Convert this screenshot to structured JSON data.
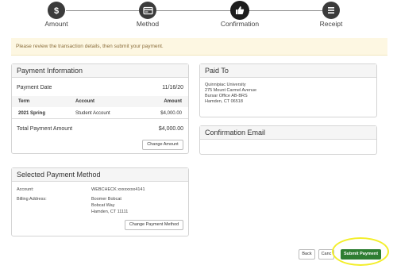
{
  "steps": [
    {
      "label": "Amount",
      "icon": "dollar-icon",
      "state": "done"
    },
    {
      "label": "Method",
      "icon": "card-icon",
      "state": "done"
    },
    {
      "label": "Confirmation",
      "icon": "thumbs-up-icon",
      "state": "active"
    },
    {
      "label": "Receipt",
      "icon": "list-icon",
      "state": "upcoming"
    }
  ],
  "banner": {
    "text": "Please review the transaction details, then submit your payment."
  },
  "payment_info": {
    "title": "Payment Information",
    "payment_date_label": "Payment Date",
    "payment_date": "11/16/20",
    "columns": [
      "Term",
      "Account",
      "Amount"
    ],
    "rows": [
      {
        "term": "2021 Spring",
        "account": "Student Account",
        "amount": "$4,000.00"
      }
    ],
    "total_label": "Total Payment Amount",
    "total": "$4,000.00",
    "change_button": "Change Amount"
  },
  "paid_to": {
    "title": "Paid To",
    "lines": [
      "Quinnipiac University",
      "275 Mount Carmel Avenue",
      "Bursar Office AB-BRS",
      "Hamden, CT 06518"
    ]
  },
  "confirmation_email": {
    "title": "Confirmation Email"
  },
  "payment_method": {
    "title": "Selected Payment Method",
    "account_label": "Account:",
    "account_value": "WEBCHECK xxxxxxxx4141",
    "billing_label": "Billing Address:",
    "billing_lines": [
      "Boomer Bobcat",
      "Bobcat Way",
      "Hamden, CT 11111"
    ],
    "change_button": "Change Payment Method"
  },
  "actions": {
    "back": "Back",
    "cancel": "Canc",
    "submit": "Submit Payment"
  },
  "colors": {
    "submit": "#2e7d32",
    "highlight": "#f3ee2a",
    "banner_bg": "#fdf7e2"
  }
}
